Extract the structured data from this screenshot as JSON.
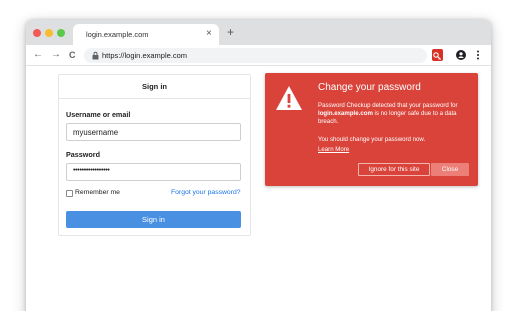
{
  "browser": {
    "tab_title": "login.example.com",
    "tab_close": "×",
    "new_tab": "+",
    "url": "https://login.example.com",
    "nav": {
      "back": "←",
      "forward": "→",
      "reload": "C"
    }
  },
  "signin": {
    "title": "Sign in",
    "username_label": "Username or email",
    "username_value": "myusername",
    "password_label": "Password",
    "password_value": "•••••••••••••••••",
    "remember_label": "Remember me",
    "forgot_link": "Forgot your password?",
    "submit_label": "Sign in"
  },
  "alert": {
    "title": "Change your password",
    "body_pre": "Password Checkup detected that your password for ",
    "body_domain": "login.example.com",
    "body_post": " is no longer safe due to a data breach.",
    "body_2": "You should change your password now.",
    "learn_more": "Learn More",
    "ignore_button": "Ignore for this site",
    "close_button": "Close",
    "color": "#d9433a"
  },
  "colors": {
    "accent": "#4a90e2",
    "link": "#1a73e8",
    "alert_red": "#d9433a"
  }
}
